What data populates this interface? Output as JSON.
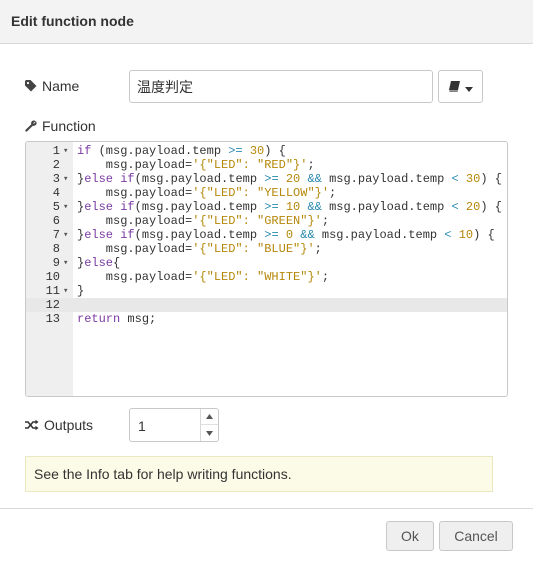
{
  "dialog": {
    "title": "Edit function node"
  },
  "name_field": {
    "label": "Name",
    "value": "温度判定",
    "icon": "tag-icon"
  },
  "library_button": {
    "icon": "book-icon",
    "caret_icon": "caret-down-icon"
  },
  "function_field": {
    "label": "Function",
    "icon": "wrench-icon"
  },
  "editor": {
    "lines": [
      {
        "n": "1",
        "fold": true,
        "code": "if (msg.payload.temp >= 30) {"
      },
      {
        "n": "2",
        "fold": false,
        "code": "    msg.payload='{\"LED\": \"RED\"}';"
      },
      {
        "n": "3",
        "fold": true,
        "code": "}else if(msg.payload.temp >= 20 && msg.payload.temp < 30) {"
      },
      {
        "n": "4",
        "fold": false,
        "code": "    msg.payload='{\"LED\": \"YELLOW\"}';"
      },
      {
        "n": "5",
        "fold": true,
        "code": "}else if(msg.payload.temp >= 10 && msg.payload.temp < 20) {"
      },
      {
        "n": "6",
        "fold": false,
        "code": "    msg.payload='{\"LED\": \"GREEN\"}';"
      },
      {
        "n": "7",
        "fold": true,
        "code": "}else if(msg.payload.temp >= 0 && msg.payload.temp < 10) {"
      },
      {
        "n": "8",
        "fold": false,
        "code": "    msg.payload='{\"LED\": \"BLUE\"}';"
      },
      {
        "n": "9",
        "fold": true,
        "code": "}else{"
      },
      {
        "n": "10",
        "fold": false,
        "code": "    msg.payload='{\"LED\": \"WHITE\"}';"
      },
      {
        "n": "11",
        "fold": true,
        "code": "}"
      },
      {
        "n": "12",
        "fold": false,
        "code": "",
        "active": true
      },
      {
        "n": "13",
        "fold": false,
        "code": "return msg;"
      }
    ]
  },
  "outputs_field": {
    "label": "Outputs",
    "value": "1",
    "icon": "random-icon"
  },
  "help_tip": {
    "text": "See the Info tab for help writing functions."
  },
  "footer": {
    "ok_label": "Ok",
    "cancel_label": "Cancel"
  },
  "colors": {
    "keyword": "#7b3aa3",
    "string": "#b5880a",
    "operator": "#2a8ab0",
    "tip_bg": "#fcfbe7"
  }
}
